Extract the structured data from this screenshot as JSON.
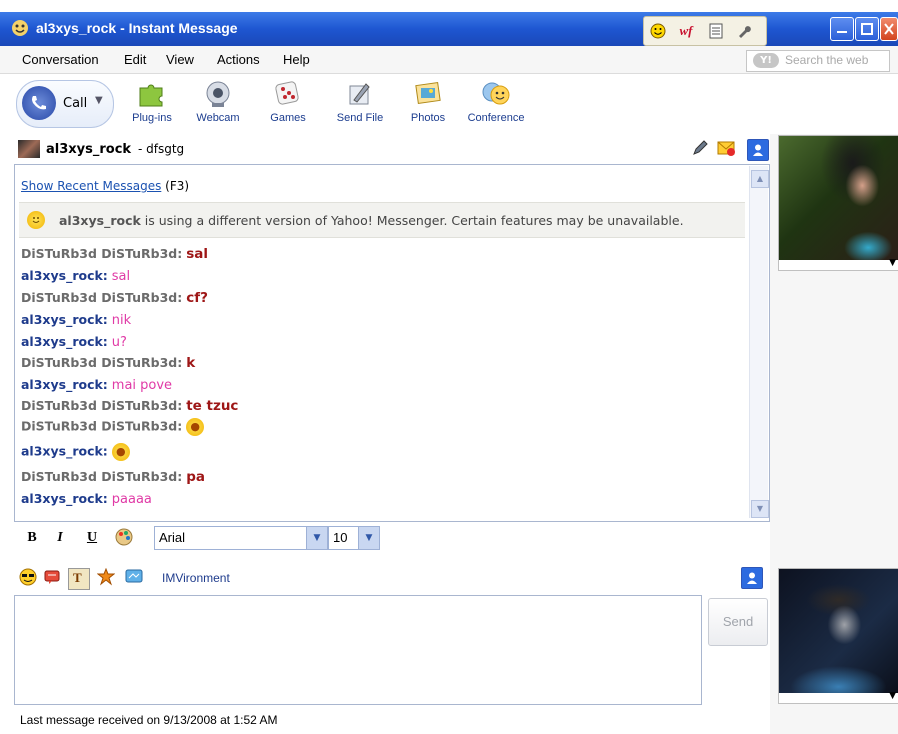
{
  "window": {
    "title": "al3xys_rock - Instant Message",
    "tray_icons": [
      "smiley-icon",
      "wf-icon",
      "notepad-icon",
      "wrench-icon"
    ],
    "tray_wf_label": "wf",
    "buttons": [
      "minimize",
      "maximize",
      "close"
    ]
  },
  "menu": {
    "items": [
      {
        "label": "Conversation"
      },
      {
        "label": "Edit"
      },
      {
        "label": "View"
      },
      {
        "label": "Actions"
      },
      {
        "label": "Help"
      }
    ],
    "search_placeholder": "Search the web"
  },
  "toolbar": {
    "call_label": "Call",
    "tools": [
      {
        "label": "Plug-ins",
        "icon": "puzzle-icon"
      },
      {
        "label": "Webcam",
        "icon": "webcam-icon"
      },
      {
        "label": "Games",
        "icon": "dice-icon"
      },
      {
        "label": "Send File",
        "icon": "send-file-icon"
      },
      {
        "label": "Photos",
        "icon": "photos-icon"
      },
      {
        "label": "Conference",
        "icon": "conference-icon"
      }
    ]
  },
  "contact": {
    "name": "al3xys_rock",
    "status": " - dfsgtg"
  },
  "conversation": {
    "show_recent": "Show Recent Messages",
    "show_recent_shortcut": "(F3)",
    "notice_user": "al3xys_rock",
    "notice_text": " is using a different version of Yahoo! Messenger. Certain features may be unavailable.",
    "messages": [
      {
        "who": "DiSTuRb3d DiSTuRb3d:",
        "text": "sal",
        "me": false
      },
      {
        "who": "al3xys_rock:",
        "text": "sal",
        "me": true
      },
      {
        "who": "DiSTuRb3d DiSTuRb3d:",
        "text": "cf?",
        "me": false
      },
      {
        "who": "al3xys_rock:",
        "text": "nik",
        "me": true
      },
      {
        "who": "al3xys_rock:",
        "text": "u?",
        "me": true
      },
      {
        "who": "DiSTuRb3d DiSTuRb3d:",
        "text": "k",
        "me": false
      },
      {
        "who": "al3xys_rock:",
        "text": "mai pove",
        "me": true
      },
      {
        "who": "DiSTuRb3d DiSTuRb3d:",
        "text": "te tzuc",
        "me": false
      },
      {
        "who": "DiSTuRb3d DiSTuRb3d:",
        "text": "",
        "me": false,
        "emoticon": "surprised-emoticon"
      },
      {
        "who": "al3xys_rock:",
        "text": "",
        "me": true,
        "emoticon": "surprised-emoticon"
      },
      {
        "who": "DiSTuRb3d DiSTuRb3d:",
        "text": "pa",
        "me": false
      },
      {
        "who": "al3xys_rock:",
        "text": "paaaa",
        "me": true
      }
    ]
  },
  "format": {
    "bold": "B",
    "italic": "I",
    "underline": "U",
    "font": "Arial",
    "size": "10"
  },
  "emobar": {
    "imvironment": "IMVironment"
  },
  "input": {
    "send_label": "Send"
  },
  "status": {
    "text": "Last message received on 9/13/2008 at 1:52 AM"
  }
}
